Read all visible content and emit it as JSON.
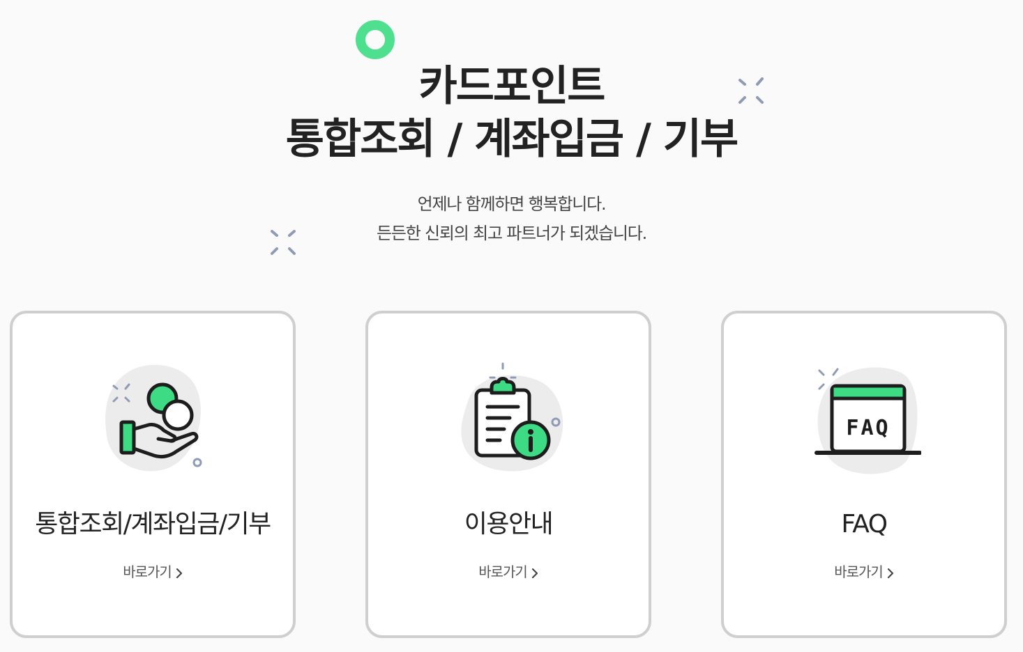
{
  "header": {
    "title_line1": "카드포인트",
    "title_line2": "통합조회 / 계좌입금 / 기부",
    "subtitle_line1": "언제나 함께하면 행복합니다.",
    "subtitle_line2": "든든한 신뢰의 최고 파트너가 되겠습니다."
  },
  "cards": [
    {
      "title": "통합조회/계좌입금/기부",
      "link_label": "바로가기",
      "icon": "hand-coins-icon"
    },
    {
      "title": "이용안내",
      "link_label": "바로가기",
      "icon": "clipboard-info-icon"
    },
    {
      "title": "FAQ",
      "link_label": "바로가기",
      "icon": "faq-window-icon",
      "icon_text": "FAQ"
    }
  ],
  "colors": {
    "accent_green": "#3ddc84",
    "deco_ring": "#4fe08f",
    "sparkle": "#8f9bb3",
    "card_border": "#cfcfcf",
    "blob": "#ececec"
  }
}
